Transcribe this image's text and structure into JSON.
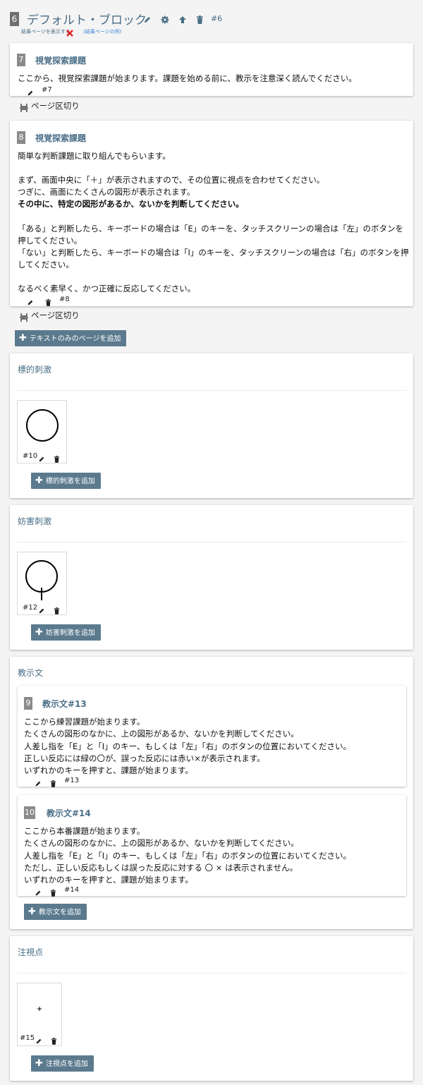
{
  "header": {
    "number": "6",
    "title": "デフォルト・ブロック",
    "id": "#6",
    "show_results": "結果ページを表示する",
    "example_link": "(結果ページの例)"
  },
  "pages": [
    {
      "badge": "7",
      "title": "視覚探索課題",
      "text": "ここから、視覚探索課題が始まります。課題を始める前に、教示を注意深く読んでください。",
      "id": "#7"
    },
    {
      "badge": "8",
      "title": "視覚探索課題",
      "intro": "簡単な判断課題に取り組んでもらいます。",
      "l1": "まず、画面中央に「＋」が表示されますので、その位置に視点を合わせてください。",
      "l2": "つぎに、画面にたくさんの図形が表示されます。",
      "l3": "その中に、特定の図形があるか、ないかを判断してください。",
      "l4": "「ある」と判断したら、キーボードの場合は「E」のキーを、タッチスクリーンの場合は「左」のボタンを押してください。",
      "l5": "「ない」と判断したら、キーボードの場合は「I」のキーを、タッチスクリーンの場合は「右」のボタンを押してください。",
      "l6": "なるべく素早く、かつ正確に反応してください。",
      "id": "#8"
    }
  ],
  "page_break": "ページ区切り",
  "add_text_page": "テキストのみのページを追加",
  "target": {
    "title": "標的刺激",
    "item_id": "#10",
    "add": "標的刺激を追加"
  },
  "distractor": {
    "title": "妨害刺激",
    "item_id": "#12",
    "add": "妨害刺激を追加"
  },
  "instructions": {
    "title": "教示文",
    "items": [
      {
        "badge": "9",
        "title": "教示文#13",
        "text": "ここから練習課題が始まります。\nたくさんの図形のなかに、上の図形があるか、ないかを判断してください。\n人差し指を「E」と「I」のキー、もしくは「左」「右」のボタンの位置においてください。\n正しい反応には緑の〇が、誤った反応には赤い×が表示されます。\nいずれかのキーを押すと、課題が始まります。",
        "id": "#13"
      },
      {
        "badge": "10",
        "title": "教示文#14",
        "text": "ここから本番課題が始まります。\nたくさんの図形のなかに、上の図形があるか、ないかを判断してください。\n人差し指を「E」と「I」のキー、もしくは「左」「右」のボタンの位置においてください。\nただし、正しい反応もしくは誤った反応に対する 〇 × は表示されません。\nいずれかのキーを押すと、課題が始まります。",
        "id": "#14"
      }
    ],
    "add": "教示文を追加"
  },
  "fixation": {
    "title": "注視点",
    "item_id": "#15",
    "add": "注視点を追加"
  },
  "colors": {
    "accent": "#4a6e87",
    "button": "#5b7a8e",
    "badge": "#8a8a8a",
    "error": "#e02020"
  }
}
